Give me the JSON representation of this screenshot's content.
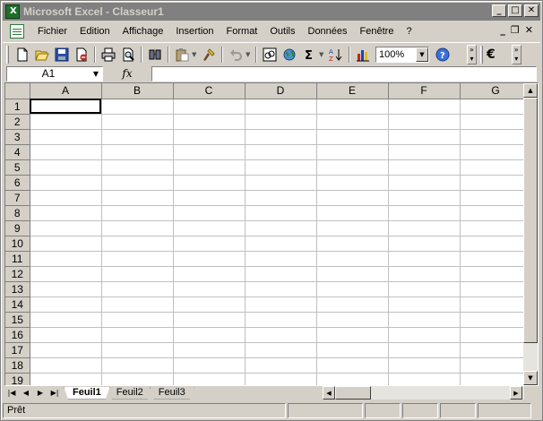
{
  "window": {
    "title": "Microsoft Excel - Classeur1",
    "caption": {
      "minimize": "_",
      "maximize": "□",
      "close": "✕"
    }
  },
  "menubar": {
    "items": [
      {
        "label": "Fichier"
      },
      {
        "label": "Edition"
      },
      {
        "label": "Affichage"
      },
      {
        "label": "Insertion"
      },
      {
        "label": "Format"
      },
      {
        "label": "Outils"
      },
      {
        "label": "Données"
      },
      {
        "label": "Fenêtre"
      },
      {
        "label": "?"
      }
    ],
    "mdi": {
      "minimize": "_",
      "restore": "❐",
      "close": "✕"
    }
  },
  "toolbar": {
    "zoom": "100%",
    "euro": "€"
  },
  "formula_bar": {
    "name_box": "A1",
    "fx_label": "fx",
    "value": ""
  },
  "sheet": {
    "columns": [
      "A",
      "B",
      "C",
      "D",
      "E",
      "F",
      "G"
    ],
    "rows": [
      "1",
      "2",
      "3",
      "4",
      "5",
      "6",
      "7",
      "8",
      "9",
      "10",
      "11",
      "12",
      "13",
      "14",
      "15",
      "16",
      "17",
      "18",
      "19"
    ]
  },
  "tabs": {
    "sheets": [
      "Feuil1",
      "Feuil2",
      "Feuil3"
    ],
    "active": "Feuil1"
  },
  "status": {
    "text": "Prêt"
  },
  "colors": {
    "title_inactive": "#808080",
    "face": "#d4d0c8",
    "excel_green": "#1f6f2c"
  }
}
